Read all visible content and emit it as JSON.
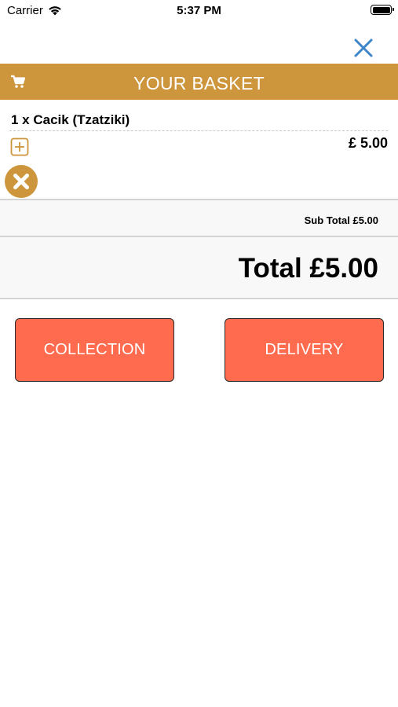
{
  "status_bar": {
    "carrier": "Carrier",
    "time": "5:37 PM",
    "battery_level": 1.0
  },
  "header": {
    "title": "YOUR BASKET",
    "accent_color": "#cd953c",
    "cart_icon": "cart-icon",
    "close_icon": "close-icon",
    "close_color": "#3f86c9"
  },
  "basket": {
    "items": [
      {
        "name": "1 x Cacik (Tzatziki)",
        "price": "£ 5.00"
      }
    ]
  },
  "summary": {
    "subtotal": "Sub Total £5.00",
    "total": "Total £5.00"
  },
  "actions": {
    "collection_label": "COLLECTION",
    "delivery_label": "DELIVERY",
    "button_color": "#ff6b4f"
  }
}
